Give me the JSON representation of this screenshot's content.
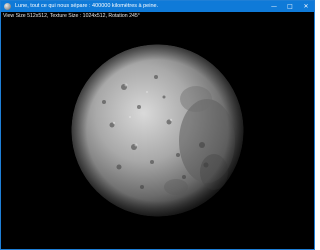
{
  "window": {
    "title": "Lune, tout ce qui nous sépare : 400000 kilomètres à peine."
  },
  "window_controls": {
    "minimize_icon": "minimize-icon",
    "maximize_icon": "maximize-icon",
    "close_icon": "close-icon"
  },
  "status": {
    "info": "View Size 512x512, Texture Size : 1024x512, Rotation 245°"
  },
  "colors": {
    "titlebar": "#0f7ad8",
    "background": "#000000",
    "status_text": "#e6e6e6"
  }
}
